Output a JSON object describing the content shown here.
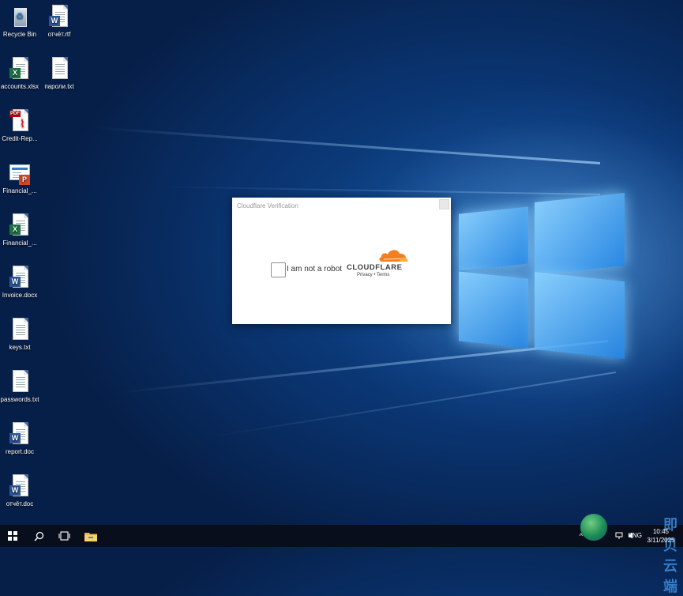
{
  "desktop": {
    "icons": [
      {
        "label": "Recycle Bin",
        "icon": "recycle-bin-icon"
      },
      {
        "label": "отчёт.rtf",
        "icon": "word-document-icon"
      },
      {
        "label": "accounts.xlsx",
        "icon": "excel-document-icon"
      },
      {
        "label": "пароли.txt",
        "icon": "text-document-icon"
      },
      {
        "label": "Credit-Rep...",
        "icon": "pdf-document-icon"
      },
      {
        "label": "Financial_...",
        "icon": "powerpoint-document-icon"
      },
      {
        "label": "Financial_...",
        "icon": "excel-document-icon"
      },
      {
        "label": "Invoice.docx",
        "icon": "word-document-icon"
      },
      {
        "label": "keys.txt",
        "icon": "text-document-icon"
      },
      {
        "label": "passwords.txt",
        "icon": "text-document-icon"
      },
      {
        "label": "report.doc",
        "icon": "word-document-icon"
      },
      {
        "label": "отчёт.doc",
        "icon": "word-document-icon"
      }
    ],
    "icon_badges": {
      "word": "W",
      "excel": "X",
      "ppt": "P",
      "pdf": "PDF"
    }
  },
  "dialog": {
    "title": "Cloudflare Verification",
    "checkbox_label": "I am not a robot",
    "brand": "CLOUDFLARE",
    "links": "Privacy • Terms"
  },
  "taskbar": {
    "language": "ENG",
    "time": "10:45",
    "date": "3/11/2025",
    "tray_chevron": "^",
    "watermark": "即贝云端"
  },
  "colors": {
    "cloudflare_orange": "#f38020",
    "cloudflare_orange_light": "#faae40",
    "word_blue": "#2b579a",
    "excel_green": "#1e7145",
    "ppt_orange": "#d24726"
  }
}
